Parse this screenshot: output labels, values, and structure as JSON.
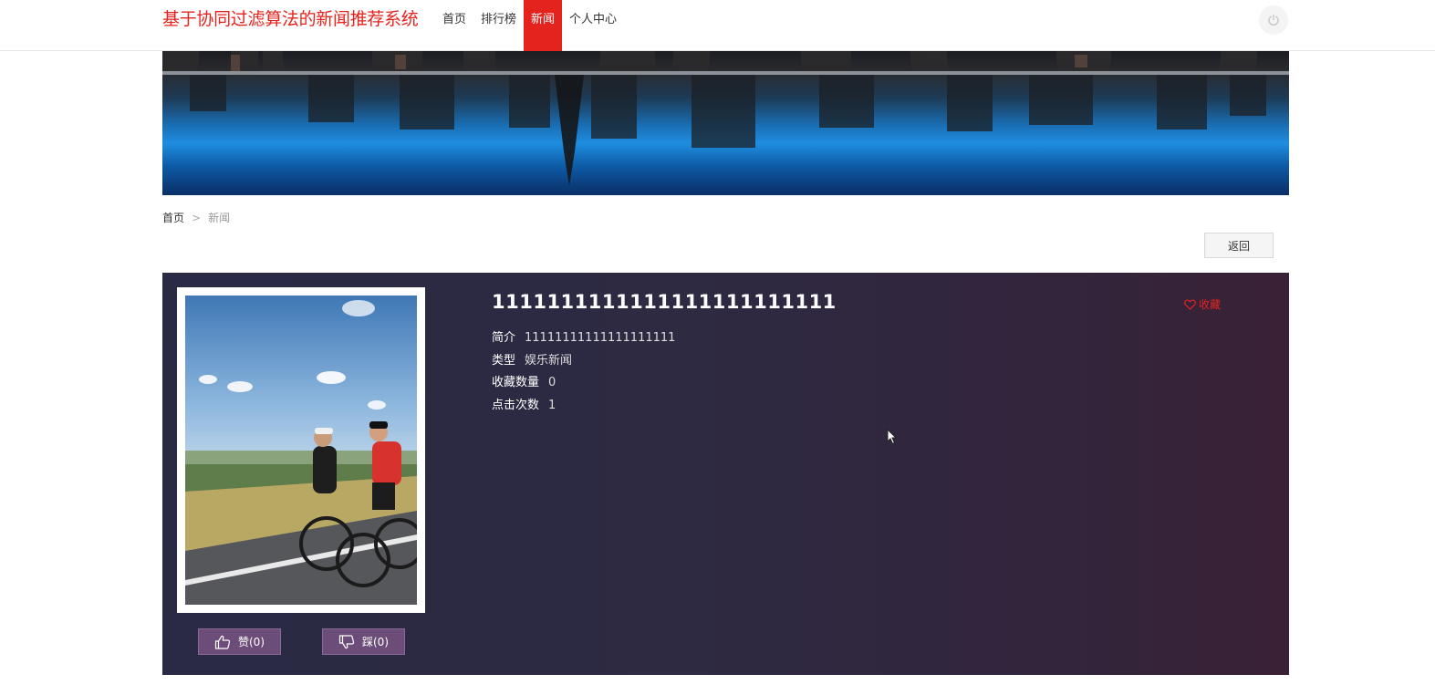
{
  "header": {
    "site_title": "基于协同过滤算法的新闻推荐系统",
    "nav": [
      {
        "label": "首页",
        "active": false
      },
      {
        "label": "排行榜",
        "active": false
      },
      {
        "label": "新闻",
        "active": true
      },
      {
        "label": "个人中心",
        "active": false
      }
    ],
    "power_icon": "power-icon",
    "accent_color": "#e4231e"
  },
  "breadcrumb": {
    "home": "首页",
    "separator": ">",
    "current": "新闻"
  },
  "actions": {
    "back_label": "返回"
  },
  "article": {
    "title": "1111111111111111111111111",
    "favorite_label": "收藏",
    "fields": [
      {
        "label": "简介",
        "value": "11111111111111111111"
      },
      {
        "label": "类型",
        "value": "娱乐新闻"
      },
      {
        "label": "收藏数量",
        "value": "0"
      },
      {
        "label": "点击次数",
        "value": "1"
      }
    ],
    "like_label": "赞(0)",
    "dislike_label": "踩(0)"
  }
}
